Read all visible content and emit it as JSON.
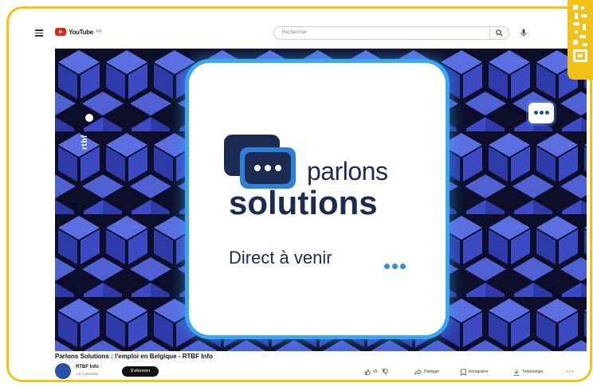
{
  "header": {
    "logo_text": "YouTube",
    "logo_sup": "FR",
    "search_placeholder": "Rechercher"
  },
  "video": {
    "channel_mark": "rtbf",
    "brand_top": "parlons",
    "brand_bottom": "solutions",
    "status_text": "Direct à venir"
  },
  "info": {
    "title": "Parlons Solutions : l'emploi en Belgique - RTBF Info",
    "channel_name": "RTBF Info",
    "subscribers": "1,8 k abonnés",
    "subscribe_label": "S'abonner",
    "like_count": "65",
    "share_label": "Partager",
    "save_label": "Enregistrer",
    "download_label": "Télécharger",
    "more_label": "···"
  },
  "colors": {
    "frame": "#f2c21a",
    "card_glow": "#3aa5f0",
    "brand_navy": "#1c2b52",
    "dots_blue": "#2e8fe0"
  }
}
